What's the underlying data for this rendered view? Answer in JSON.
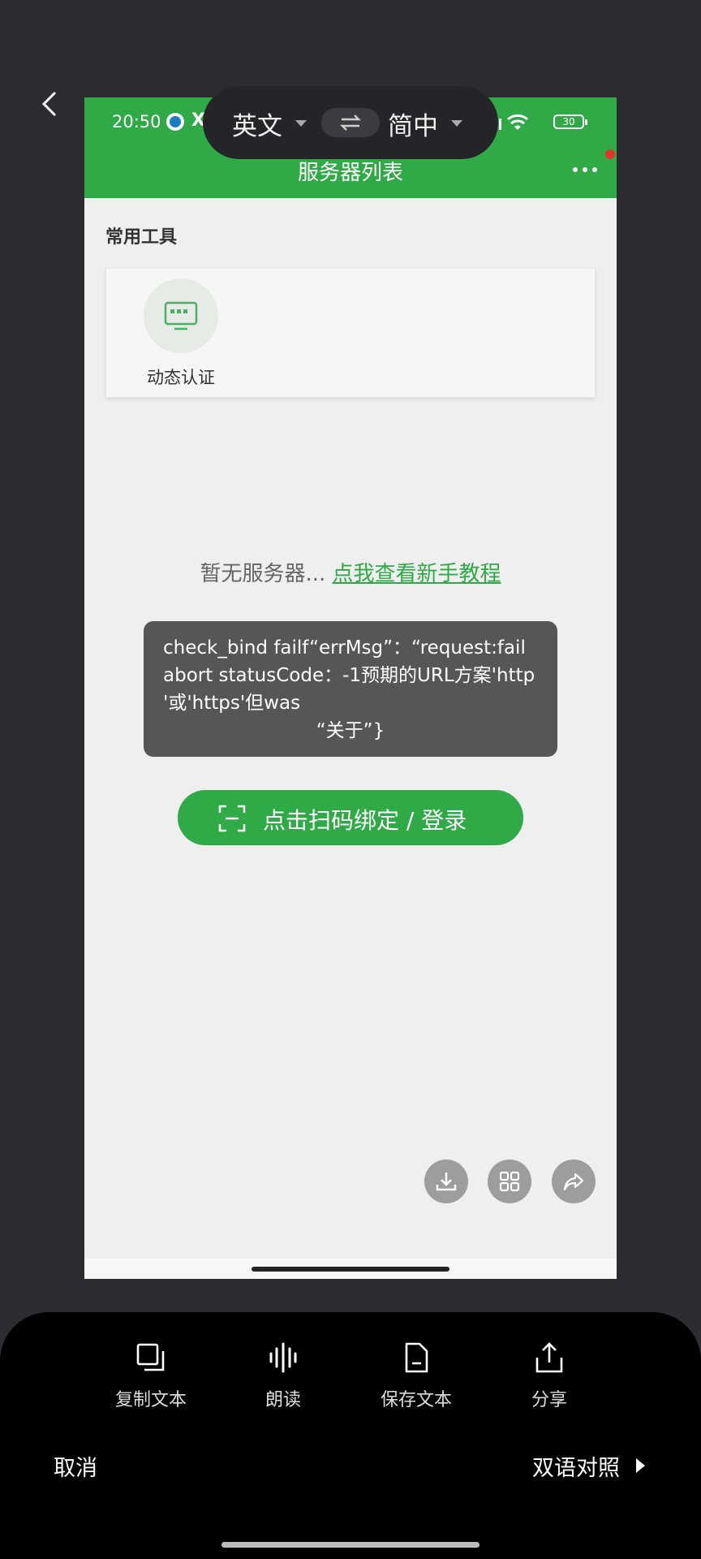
{
  "status_bar": {
    "time": "20:50",
    "notification_glyph": "X",
    "battery": "30"
  },
  "header": {
    "title": "服务器列表"
  },
  "tools": {
    "section_title": "常用工具",
    "items": [
      {
        "label": "动态认证",
        "icon": "monitor-icon"
      }
    ]
  },
  "empty_state": {
    "text": "暂无服务器...",
    "link": "点我查看新手教程"
  },
  "toast": {
    "lines": [
      "check_bind failf“errMsg”：“request:fail",
      "abort statusCode：-1预期的URL方案'http",
      "'或'https'但was"
    ],
    "last_line": "“关于”}"
  },
  "scan_button": {
    "label": "点击扫码绑定 / 登录"
  },
  "floating_actions": [
    "download-icon",
    "grid-icon",
    "share-arrow-icon"
  ],
  "translation_bar": {
    "source_lang": "英文",
    "target_lang": "简中"
  },
  "bottom_sheet": {
    "actions": [
      {
        "label": "复制文本",
        "icon": "copy-icon"
      },
      {
        "label": "朗读",
        "icon": "voice-icon"
      },
      {
        "label": "保存文本",
        "icon": "document-icon"
      },
      {
        "label": "分享",
        "icon": "share-icon"
      }
    ],
    "cancel": "取消",
    "bilingual": "双语对照"
  },
  "colors": {
    "brand_green": "#2faa47",
    "toast_bg": "#565656",
    "sheet_bg": "#000000"
  }
}
